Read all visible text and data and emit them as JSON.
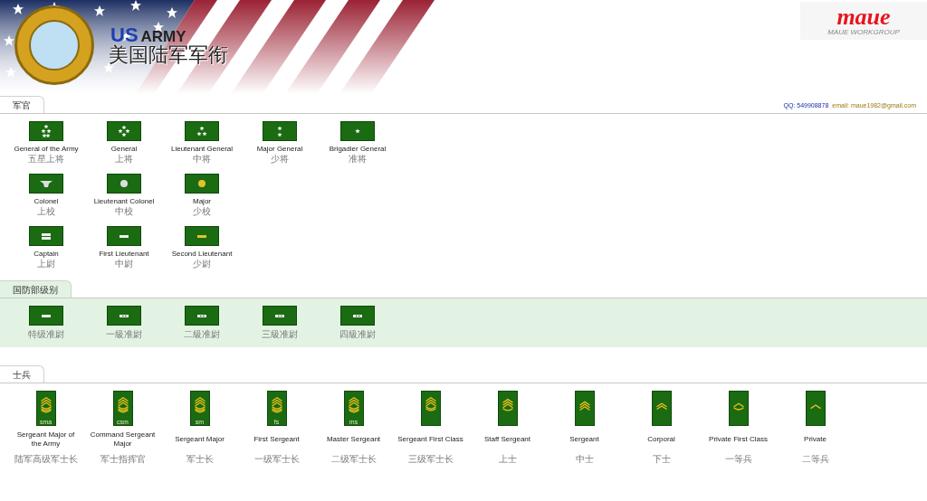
{
  "header": {
    "brand_us": "US",
    "brand_army": "ARMY",
    "title": "美国陆军军衔",
    "logo": "maue",
    "logo_sub": "MAUE WORKGROUP"
  },
  "contact": {
    "qq": "QQ: 549908878",
    "email": "email: maue1982@gmail.com"
  },
  "sections": [
    {
      "tab": "军官",
      "shaded": false,
      "kind": "officer",
      "rows": [
        [
          {
            "name": "General of the Army",
            "cn": "五星上将",
            "kind": "star5"
          },
          {
            "name": "General",
            "cn": "上将",
            "kind": "star4"
          },
          {
            "name": "Lieutenant General",
            "cn": "中将",
            "kind": "star3"
          },
          {
            "name": "Major General",
            "cn": "少将",
            "kind": "star2"
          },
          {
            "name": "Brigadier General",
            "cn": "准将",
            "kind": "star1"
          }
        ],
        [
          {
            "name": "Colonel",
            "cn": "上校",
            "kind": "eagle"
          },
          {
            "name": "Lieutenant Colonel",
            "cn": "中校",
            "kind": "leaf_silver"
          },
          {
            "name": "Major",
            "cn": "少校",
            "kind": "leaf_gold"
          }
        ],
        [
          {
            "name": "Captain",
            "cn": "上尉",
            "kind": "bars2"
          },
          {
            "name": "First Lieutenant",
            "cn": "中尉",
            "kind": "bar_silver"
          },
          {
            "name": "Second Lieutenant",
            "cn": "少尉",
            "kind": "bar_gold"
          }
        ]
      ]
    },
    {
      "tab": "国防部级别",
      "shaded": true,
      "kind": "officer",
      "rows": [
        [
          {
            "cn": "特级准尉",
            "kind": "bar_silver"
          },
          {
            "cn": "一級准尉",
            "kind": "bar_dots"
          },
          {
            "cn": "二級准尉",
            "kind": "bar_dots"
          },
          {
            "cn": "三級准尉",
            "kind": "bar_dots"
          },
          {
            "cn": "四級准尉",
            "kind": "bar_dots"
          }
        ]
      ]
    },
    {
      "tab": "士兵",
      "shaded": false,
      "kind": "enlisted",
      "rows": [
        [
          {
            "name": "Sergeant Major of the Army",
            "cn": "陆军高级军士长",
            "kind": "chev3rock3",
            "badge_text": "sma"
          },
          {
            "name": "Command Sergeant Major",
            "cn": "军士指挥官",
            "kind": "chev3rock3",
            "badge_text": "csm"
          },
          {
            "name": "Sergeant Major",
            "cn": "军士长",
            "kind": "chev3rock3",
            "badge_text": "sm"
          },
          {
            "name": "First Sergeant",
            "cn": "一级军士长",
            "kind": "chev3rock3",
            "badge_text": "fs"
          },
          {
            "name": "Master Sergeant",
            "cn": "二级军士长",
            "kind": "chev3rock3",
            "badge_text": "ms"
          },
          {
            "name": "Sergeant First Class",
            "cn": "三级军士长",
            "kind": "chev3rock2"
          },
          {
            "name": "Staff Sergeant",
            "cn": "上士",
            "kind": "chev3rock1"
          },
          {
            "name": "Sergeant",
            "cn": "中士",
            "kind": "chev3"
          },
          {
            "name": "Corporal",
            "cn": "下士",
            "kind": "chev2"
          },
          {
            "name": "Private First Class",
            "cn": "一等兵",
            "kind": "chev1rock1"
          },
          {
            "name": "Private",
            "cn": "二等兵",
            "kind": "chev1"
          }
        ]
      ]
    }
  ]
}
